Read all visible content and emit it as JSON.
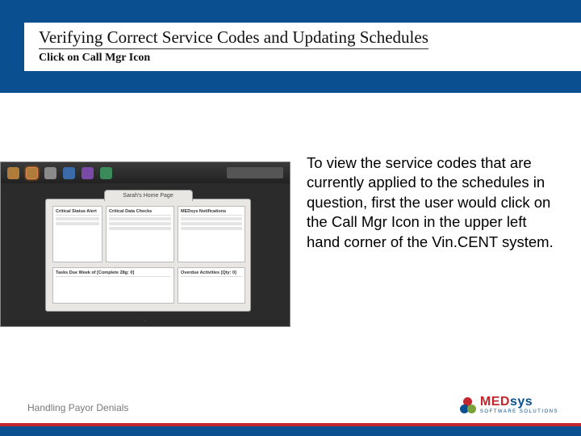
{
  "header": {
    "title": "Verifying Correct Service Codes and Updating Schedules",
    "subtitle": "Click on Call Mgr Icon"
  },
  "screenshot": {
    "window_title": "Sarah's Home Page",
    "panes": {
      "p1": "Critical Status Alert",
      "p2": "Critical Data Checks",
      "p3": "MEDsys Notifications",
      "p4": "Tasks Due Week of [Complete 28g: 0]",
      "p5": "Overdue Activities [Qty: 0]"
    }
  },
  "body": {
    "paragraph": "To view the service codes that are currently applied to the schedules in question, first the user would click on the Call Mgr Icon in the upper left hand corner of the Vin.CENT system."
  },
  "footer": {
    "text": "Handling Payor Denials",
    "logo_brand_prefix": "MED",
    "logo_brand_suffix": "sys",
    "logo_subline": "SOFTWARE SOLUTIONS"
  }
}
